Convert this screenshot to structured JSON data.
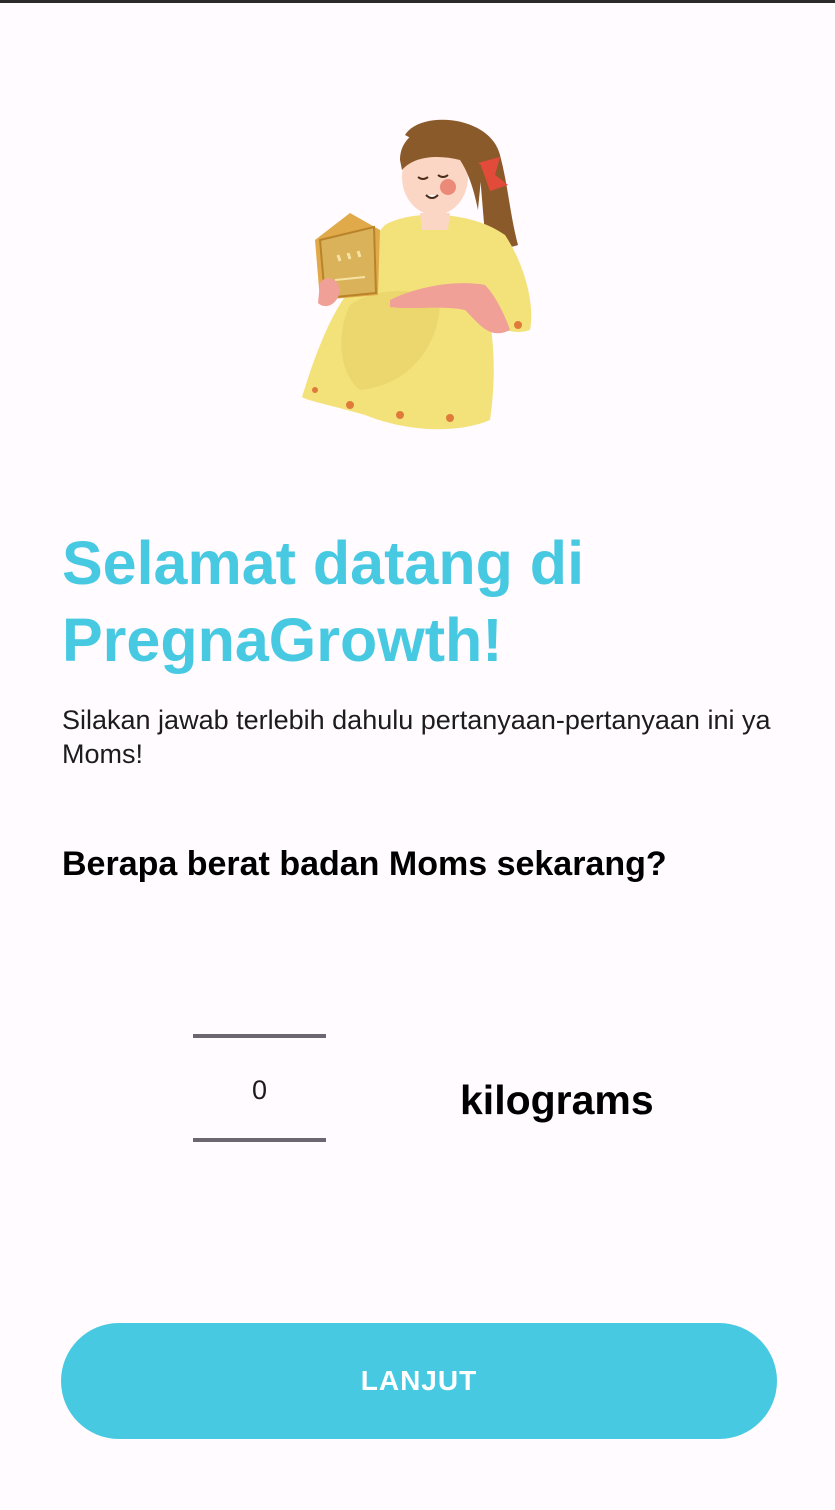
{
  "illustration": {
    "icon": "pregnant-woman-reading-illustration"
  },
  "welcome": {
    "title": "Selamat datang di PregnaGrowth!",
    "subtitle": "Silakan jawab terlebih dahulu pertanyaan-pertanyaan ini ya Moms!"
  },
  "question": {
    "text": "Berapa berat badan Moms sekarang?"
  },
  "weight_picker": {
    "value": "0",
    "unit": "kilograms"
  },
  "actions": {
    "next_label": "LANJUT"
  },
  "colors": {
    "accent": "#48c9e2",
    "background": "#fffbfe",
    "text": "#000000"
  }
}
